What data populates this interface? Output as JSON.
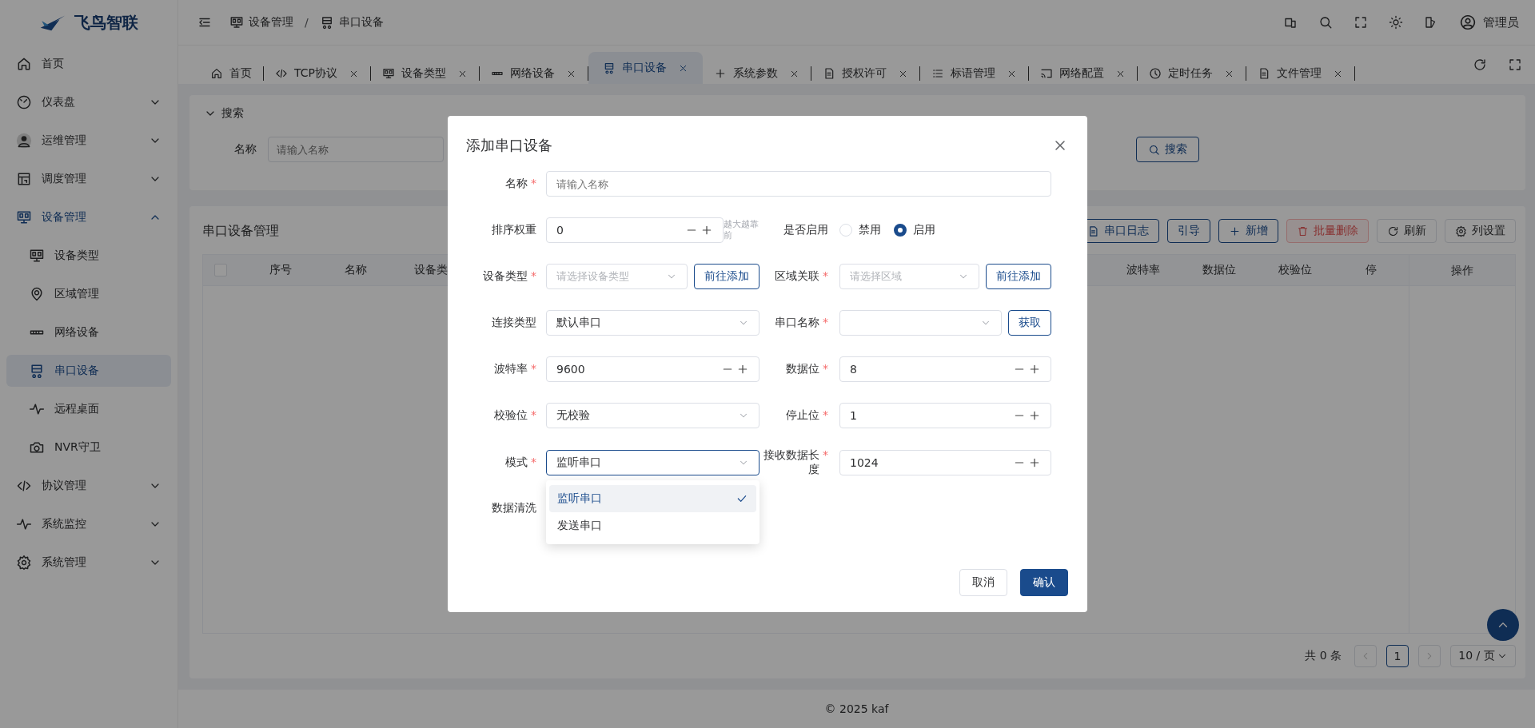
{
  "brand": {
    "name": "飞鸟智联"
  },
  "header": {
    "breadcrumb": [
      {
        "label": "设备管理"
      },
      {
        "label": "串口设备"
      }
    ],
    "separator": "/",
    "user": "管理员"
  },
  "sidebar": {
    "items": [
      {
        "label": "首页",
        "selected": false
      },
      {
        "label": "仪表盘",
        "selected": false,
        "expanded": false
      },
      {
        "label": "运维管理",
        "selected": false,
        "expanded": false
      },
      {
        "label": "调度管理",
        "selected": false,
        "expanded": false
      },
      {
        "label": "设备管理",
        "selected": false,
        "expanded": true,
        "children": [
          {
            "label": "设备类型",
            "selected": false
          },
          {
            "label": "区域管理",
            "selected": false
          },
          {
            "label": "网络设备",
            "selected": false
          },
          {
            "label": "串口设备",
            "selected": true
          },
          {
            "label": "远程桌面",
            "selected": false
          },
          {
            "label": "NVR守卫",
            "selected": false
          }
        ]
      },
      {
        "label": "协议管理",
        "selected": false,
        "expanded": false
      },
      {
        "label": "系统监控",
        "selected": false,
        "expanded": false
      },
      {
        "label": "系统管理",
        "selected": false,
        "expanded": false
      }
    ]
  },
  "tabs": [
    {
      "label": "首页",
      "selected": false,
      "closable": false
    },
    {
      "label": "TCP协议",
      "selected": false,
      "closable": true
    },
    {
      "label": "设备类型",
      "selected": false,
      "closable": true
    },
    {
      "label": "网络设备",
      "selected": false,
      "closable": true
    },
    {
      "label": "串口设备",
      "selected": true,
      "closable": true
    },
    {
      "label": "系统参数",
      "selected": false,
      "closable": true
    },
    {
      "label": "授权许可",
      "selected": false,
      "closable": true
    },
    {
      "label": "标语管理",
      "selected": false,
      "closable": true
    },
    {
      "label": "网络配置",
      "selected": false,
      "closable": true
    },
    {
      "label": "定时任务",
      "selected": false,
      "closable": true
    },
    {
      "label": "文件管理",
      "selected": false,
      "closable": true
    }
  ],
  "search": {
    "title": "搜索",
    "expanded": true,
    "label": "名称",
    "placeholder": "请输入名称",
    "button": "搜索"
  },
  "table": {
    "title": "串口设备管理",
    "actions": [
      {
        "label": "串口日志",
        "kind": "outline",
        "disabled": false
      },
      {
        "label": "引导",
        "kind": "outline",
        "disabled": false
      },
      {
        "label": "新增",
        "kind": "outline",
        "disabled": false
      },
      {
        "label": "批量删除",
        "kind": "danger",
        "disabled": true
      },
      {
        "label": "刷新",
        "kind": "plain",
        "disabled": false
      },
      {
        "label": "列设置",
        "kind": "plain",
        "disabled": false
      }
    ],
    "select_all": {
      "checked": false
    },
    "columns_left": [
      "序号",
      "名称",
      "设备类"
    ],
    "columns_right": [
      "波特率",
      "数据位",
      "校验位",
      "停"
    ],
    "action_column": "操作"
  },
  "pagination": {
    "total": "共 0 条",
    "pages": [
      {
        "label": "1",
        "selected": true
      }
    ],
    "page_size": "10 / 页"
  },
  "footer": "© 2025 kaf",
  "dialog": {
    "title": "添加串口设备",
    "required_mark": "*",
    "rows": [
      [
        {
          "label": "名称",
          "required": true,
          "kind": "input",
          "placeholder": "请输入名称"
        }
      ],
      [
        {
          "label": "排序权重",
          "required": false,
          "kind": "number",
          "value": "0",
          "hint": "越大越靠前"
        },
        {
          "label": "是否启用",
          "required": false,
          "kind": "radio",
          "options": [
            {
              "label": "禁用",
              "selected": false
            },
            {
              "label": "启用",
              "selected": true
            }
          ]
        }
      ],
      [
        {
          "label": "设备类型",
          "required": true,
          "kind": "select",
          "placeholder": "请选择设备类型",
          "button": "前往添加"
        },
        {
          "label": "区域关联",
          "required": true,
          "kind": "select",
          "placeholder": "请选择区域",
          "button": "前往添加"
        }
      ],
      [
        {
          "label": "连接类型",
          "required": false,
          "kind": "select",
          "value": "默认串口"
        },
        {
          "label": "串口名称",
          "required": true,
          "kind": "select",
          "button": "获取"
        }
      ],
      [
        {
          "label": "波特率",
          "required": true,
          "kind": "number",
          "value": "9600"
        },
        {
          "label": "数据位",
          "required": true,
          "kind": "number",
          "value": "8"
        }
      ],
      [
        {
          "label": "校验位",
          "required": true,
          "kind": "select",
          "value": "无校验"
        },
        {
          "label": "停止位",
          "required": true,
          "kind": "number",
          "value": "1"
        }
      ],
      [
        {
          "label": "模式",
          "required": true,
          "kind": "select",
          "value": "监听串口",
          "focused": true,
          "open": true,
          "options": [
            {
              "label": "监听串口",
              "selected": true
            },
            {
              "label": "发送串口",
              "selected": false
            }
          ]
        },
        {
          "label": "接收数据长度",
          "required": true,
          "kind": "number",
          "value": "1024"
        }
      ],
      [
        {
          "label": "数据清洗",
          "required": false,
          "kind": "label"
        }
      ]
    ],
    "buttons": [
      {
        "label": "取消",
        "kind": "default"
      },
      {
        "label": "确认",
        "kind": "primary"
      }
    ]
  }
}
